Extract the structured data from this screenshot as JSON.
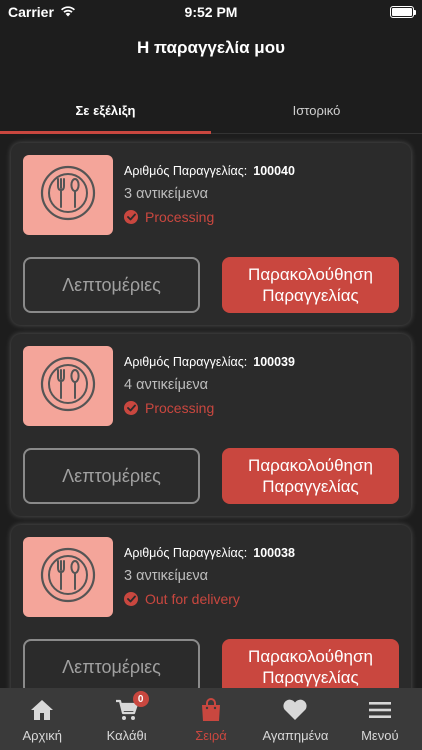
{
  "status_bar": {
    "carrier": "Carrier",
    "time": "9:52 PM"
  },
  "header": {
    "title": "Η παραγγελία μου"
  },
  "tabs": [
    {
      "label": "Σε εξέλιξη",
      "active": true
    },
    {
      "label": "Ιστορικό",
      "active": false
    }
  ],
  "orders": [
    {
      "order_label": "Αριθμός Παραγγελίας:",
      "order_number": "100040",
      "items": "3 αντικείμενα",
      "status": "Processing",
      "details_label": "Λεπτομέριες",
      "track_label": "Παρακολούθηση Παραγγελίας"
    },
    {
      "order_label": "Αριθμός Παραγγελίας:",
      "order_number": "100039",
      "items": "4 αντικείμενα",
      "status": "Processing",
      "details_label": "Λεπτομέριες",
      "track_label": "Παρακολούθηση Παραγγελίας"
    },
    {
      "order_label": "Αριθμός Παραγγελίας:",
      "order_number": "100038",
      "items": "3 αντικείμενα",
      "status": "Out for delivery",
      "details_label": "Λεπτομέριες",
      "track_label": "Παρακολούθηση Παραγγελίας"
    }
  ],
  "tabbar": [
    {
      "label": "Αρχική",
      "icon": "home-icon",
      "active": false
    },
    {
      "label": "Καλάθι",
      "icon": "cart-icon",
      "active": false,
      "badge": "0"
    },
    {
      "label": "Σειρά",
      "icon": "bag-icon",
      "active": true
    },
    {
      "label": "Αγαπημένα",
      "icon": "heart-icon",
      "active": false
    },
    {
      "label": "Μενού",
      "icon": "menu-icon",
      "active": false
    }
  ],
  "colors": {
    "accent": "#c9473f",
    "background": "#1d1d1d",
    "card": "#2b2b2b",
    "thumb": "#f4a59a"
  }
}
